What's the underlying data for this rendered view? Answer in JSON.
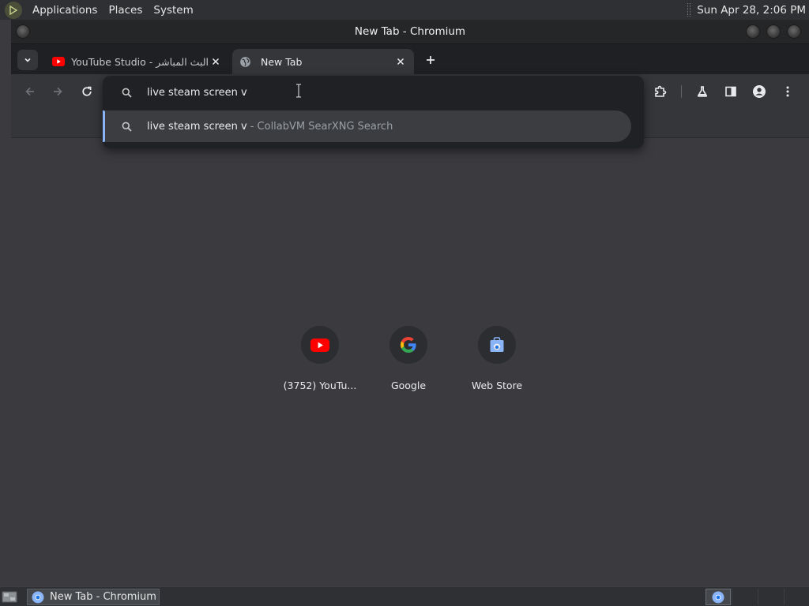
{
  "panel": {
    "applications": "Applications",
    "places": "Places",
    "system": "System",
    "clock": "Sun Apr 28,  2:06 PM"
  },
  "window": {
    "title": "New Tab - Chromium"
  },
  "tabs": [
    {
      "title": "البث المباشر - YouTube Studio",
      "favicon": "youtube-icon",
      "active": false
    },
    {
      "title": "New Tab",
      "favicon": "globe-icon",
      "active": true
    }
  ],
  "omnibox": {
    "value": "live steam screen v",
    "suggestion": {
      "text": "live steam screen v",
      "provider": "- CollabVM SearXNG Search"
    }
  },
  "shortcuts": [
    {
      "label": "(3752) YouTu...",
      "icon": "youtube-icon"
    },
    {
      "label": "Google",
      "icon": "google-icon"
    },
    {
      "label": "Web Store",
      "icon": "web-store-icon"
    }
  ],
  "taskbar": {
    "item": "New Tab - Chromium"
  },
  "colors": {
    "accent": "#8ab4f8",
    "youtube": "#ff0000",
    "page_bg": "#3b3b3f"
  }
}
